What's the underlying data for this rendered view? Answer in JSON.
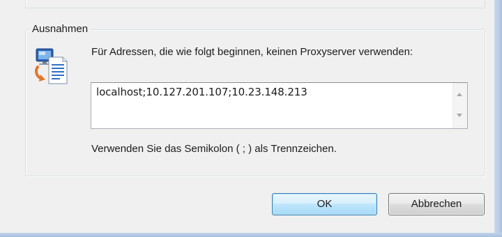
{
  "exceptions": {
    "group_title": "Ausnahmen",
    "description": "Für Adressen, die wie folgt beginnen, keinen Proxyserver verwenden:",
    "textbox_value": "localhost;10.127.201.107;10.23.148.213",
    "hint": "Verwenden Sie das Semikolon ( ; ) als Trennzeichen.",
    "icon": "network-document-icon"
  },
  "buttons": {
    "ok_label": "OK",
    "cancel_label": "Abbrechen"
  },
  "colors": {
    "dialog_background": "#f0f0f0",
    "ok_border": "#3c7fb1",
    "frame": "#b8cde6"
  }
}
